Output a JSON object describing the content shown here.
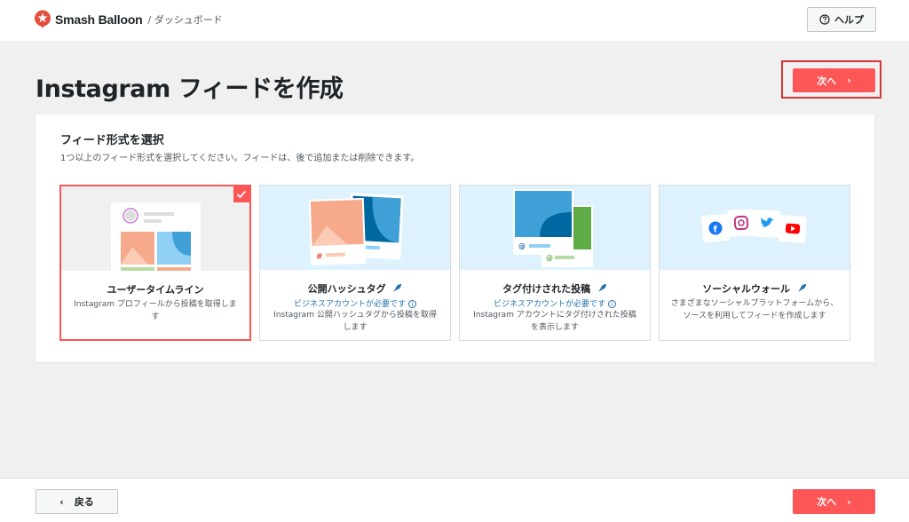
{
  "header": {
    "brand": "Smash Balloon",
    "breadcrumb": "/ ダッシュボード",
    "help_label": "ヘルプ"
  },
  "page": {
    "title": "Instagram フィードを作成",
    "next_label": "次へ"
  },
  "panel": {
    "title": "フィード形式を選択",
    "subtitle": "1つ以上のフィード形式を選択してください。フィードは、後で追加または削除できます。",
    "cards": [
      {
        "title": "ユーザータイムライン",
        "desc": "Instagram プロフィールから投稿を取得します",
        "selected": true
      },
      {
        "title": "公開ハッシュタグ",
        "biz": "ビジネスアカウントが必要です",
        "desc": "Instagram 公開ハッシュタグから投稿を取得します"
      },
      {
        "title": "タグ付けされた投稿",
        "biz": "ビジネスアカウントが必要です",
        "desc": "Instagram アカウントにタグ付けされた投稿を表示します"
      },
      {
        "title": "ソーシャルウォール",
        "desc": "さまざまなソーシャルプラットフォームから、ソースを利用してフィードを作成します"
      }
    ]
  },
  "footer": {
    "back_label": "戻る",
    "next_label": "次へ"
  },
  "colors": {
    "accent": "#fd5656",
    "link": "#2271b1",
    "highlight_border": "#d63638"
  }
}
